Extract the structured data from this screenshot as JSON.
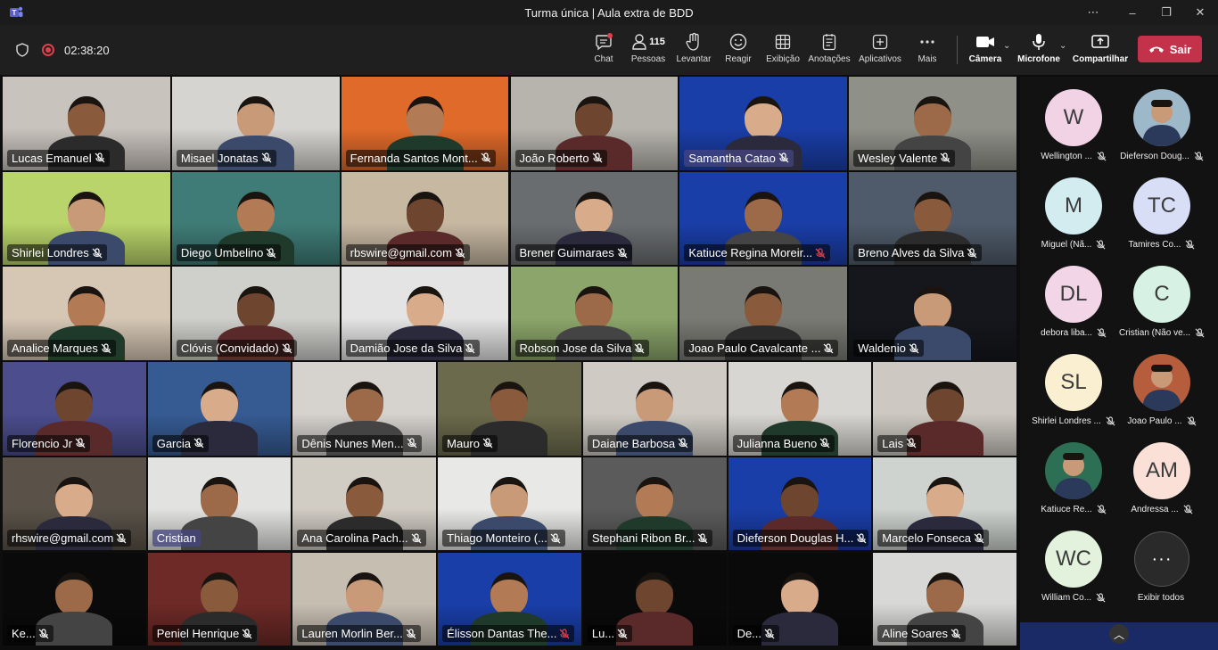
{
  "window": {
    "title": "Turma única | Aula extra de BDD",
    "more_icon": "⋯",
    "minimize_icon": "–",
    "maximize_icon": "❐",
    "close_icon": "✕"
  },
  "meeting": {
    "timer": "02:38:20"
  },
  "toolbar": {
    "chat": "Chat",
    "people": "Pessoas",
    "people_count": "115",
    "raise": "Levantar",
    "react": "Reagir",
    "view": "Exibição",
    "notes": "Anotações",
    "apps": "Aplicativos",
    "more": "Mais",
    "camera": "Câmera",
    "mic": "Microfone",
    "share": "Compartilhar",
    "leave": "Sair"
  },
  "grid_rows": [
    [
      {
        "name": "Lucas Emanuel",
        "bg": "#c9c3bd"
      },
      {
        "name": "Misael Jonatas",
        "bg": "#d6d4d0"
      },
      {
        "name": "Fernanda Santos Mont...",
        "bg": "#e06a2a"
      },
      {
        "name": "João Roberto",
        "bg": "#b6b4ad"
      },
      {
        "name": "Samantha Catao",
        "bg": "#1a3ea8",
        "highlight": true
      },
      {
        "name": "Wesley Valente",
        "bg": "#8f9088"
      }
    ],
    [
      {
        "name": "Shirlei Londres",
        "bg": "#b9d46a"
      },
      {
        "name": "Diego Umbelino",
        "bg": "#3f7c77"
      },
      {
        "name": "rbswire@gmail.com",
        "bg": "#c7b8a2"
      },
      {
        "name": "Brener Guimaraes",
        "bg": "#6a6d70"
      },
      {
        "name": "Katiuce Regina Moreir...",
        "bg": "#1a3ea8",
        "mic_off": true
      },
      {
        "name": "Breno Alves da Silva",
        "bg": "#4f5b6a"
      }
    ],
    [
      {
        "name": "Analice Marques",
        "bg": "#d6c7b5"
      },
      {
        "name": "Clóvis (Convidado)",
        "bg": "#cfcfcc"
      },
      {
        "name": "Damião Jose da Silva",
        "bg": "#e4e4e4"
      },
      {
        "name": "Robson Jose da Silva",
        "bg": "#8ba56a"
      },
      {
        "name": "Joao Paulo Cavalcante ...",
        "bg": "#7a7a74"
      },
      {
        "name": "Waldenio",
        "bg": "#15171c"
      }
    ],
    [
      {
        "name": "Florencio Jr",
        "bg": "#4b4d8d"
      },
      {
        "name": "Garcia",
        "bg": "#365b93"
      },
      {
        "name": "Dênis Nunes Men...",
        "bg": "#d6d3cf"
      },
      {
        "name": "Mauro",
        "bg": "#6b6a4c"
      },
      {
        "name": "Daiane Barbosa",
        "bg": "#cfcbc4"
      },
      {
        "name": "Julianna Bueno",
        "bg": "#d8d6d2"
      },
      {
        "name": "Lais",
        "bg": "#cdc9c2"
      }
    ],
    [
      {
        "name": "rhswire@gmail.com",
        "bg": "#5a5248"
      },
      {
        "name": "Cristian",
        "bg": "#e2e2e0",
        "highlight": true,
        "hide_mic": true
      },
      {
        "name": "Ana Carolina Pach...",
        "bg": "#d1ccc4"
      },
      {
        "name": "Thiago Monteiro (...",
        "bg": "#e8e8e6"
      },
      {
        "name": "Stephani Ribon Br...",
        "bg": "#5b5b5b"
      },
      {
        "name": "Dieferson Douglas H...",
        "bg": "#1a3ea8"
      },
      {
        "name": "Marcelo Fonseca",
        "bg": "#ced3cf"
      }
    ],
    [
      {
        "name": "Ke...",
        "bg": "#0a0a0a"
      },
      {
        "name": "Peniel Henrique",
        "bg": "#6d2a26"
      },
      {
        "name": "Lauren Morlin Ber...",
        "bg": "#c7beb2"
      },
      {
        "name": "Élisson Dantas The...",
        "bg": "#1a3ea8",
        "mic_off": true
      },
      {
        "name": "Lu...",
        "bg": "#0a0a0a"
      },
      {
        "name": "De...",
        "bg": "#0a0a0a"
      },
      {
        "name": "Aline Soares",
        "bg": "#d8d8d6"
      }
    ]
  ],
  "sidebar": {
    "participants": [
      {
        "initials": "W",
        "label": "Wellington ...",
        "bg": "#f2d3e6"
      },
      {
        "initials": "",
        "label": "Dieferson Doug...",
        "bg": "#9db8c9",
        "photo": true
      },
      {
        "initials": "M",
        "label": "Miguel (Nã...",
        "bg": "#d3ecf0"
      },
      {
        "initials": "TC",
        "label": "Tamires Co...",
        "bg": "#d9def7"
      },
      {
        "initials": "DL",
        "label": "debora liba...",
        "bg": "#f2d5e6"
      },
      {
        "initials": "C",
        "label": "Cristian (Não ve...",
        "bg": "#d7f2e4"
      },
      {
        "initials": "SL",
        "label": "Shirlei Londres ...",
        "bg": "#fbefd2"
      },
      {
        "initials": "",
        "label": "Joao Paulo ...",
        "bg": "#b55d3c",
        "photo": true
      },
      {
        "initials": "",
        "label": "Katiuce Re...",
        "bg": "#2d6f55",
        "photo": true
      },
      {
        "initials": "AM",
        "label": "Andressa ...",
        "bg": "#fbe0d8"
      },
      {
        "initials": "WC",
        "label": "William Co...",
        "bg": "#e3f2dc"
      }
    ],
    "show_all": "Exibir todos",
    "show_all_icon": "···"
  }
}
